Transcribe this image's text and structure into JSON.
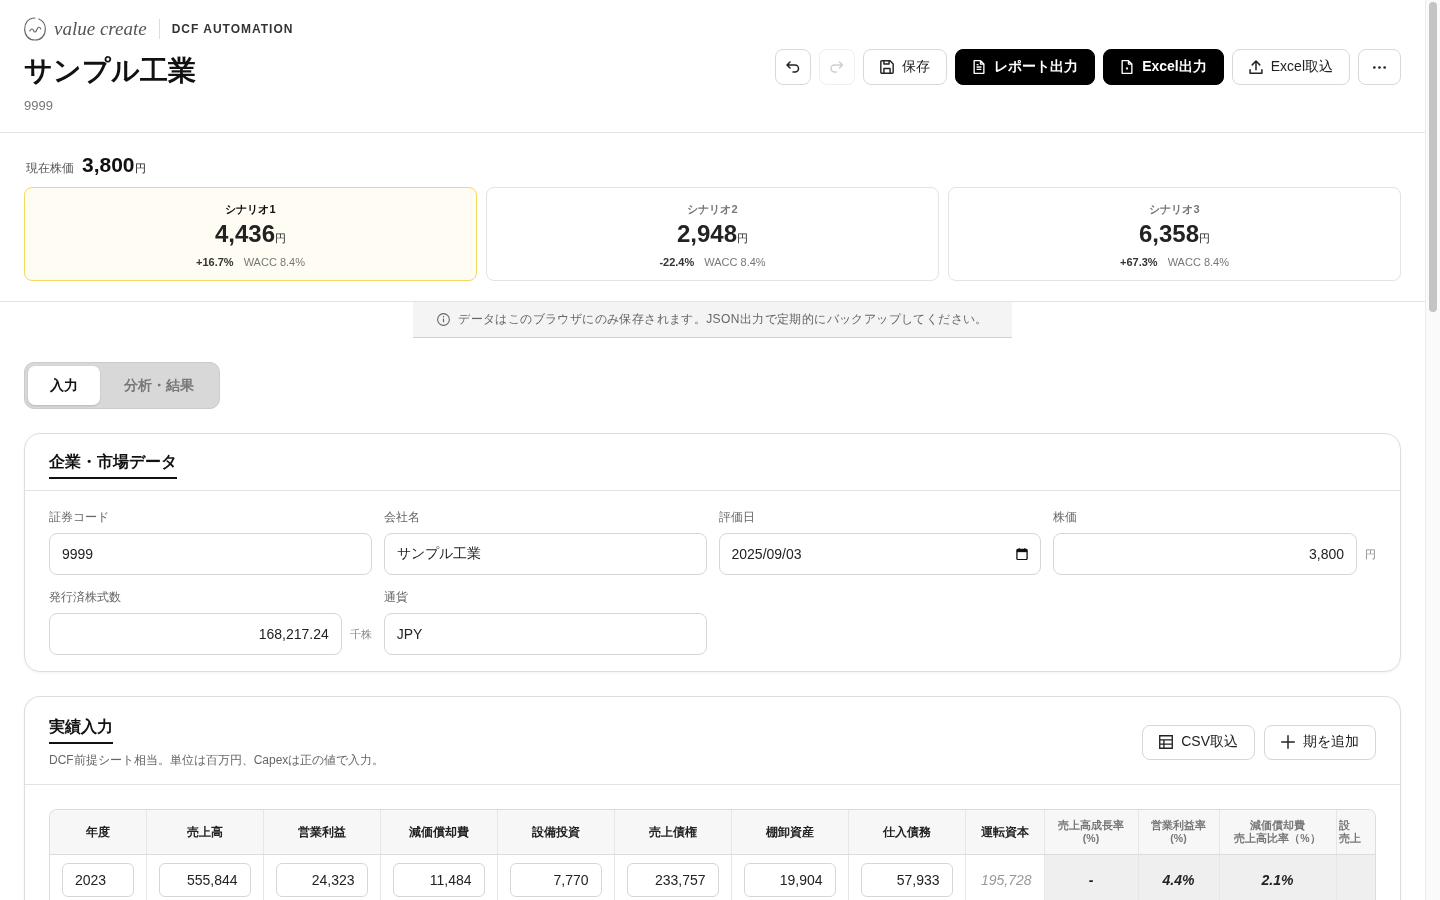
{
  "header": {
    "brand": "value create",
    "product": "DCF AUTOMATION",
    "company_name": "サンプル工業",
    "code": "9999"
  },
  "toolbar": [
    {
      "kind": "undo",
      "disabled": false,
      "primary": false
    },
    {
      "kind": "redo",
      "disabled": true,
      "primary": false
    },
    {
      "kind": "save",
      "label": "保存",
      "disabled": false,
      "primary": false
    },
    {
      "kind": "report",
      "label": "レポート出力",
      "disabled": false,
      "primary": true
    },
    {
      "kind": "excel_export",
      "label": "Excel出力",
      "disabled": false,
      "primary": true
    },
    {
      "kind": "excel_import",
      "label": "Excel取込",
      "disabled": false,
      "primary": false
    },
    {
      "kind": "more",
      "disabled": false,
      "primary": false
    }
  ],
  "current_price": {
    "label": "現在株価",
    "value": "3,800",
    "unit": "円"
  },
  "scenarios": [
    {
      "name": "シナリオ1",
      "value": "4,436",
      "unit": "円",
      "change": "+16.7%",
      "wacc": "WACC 8.4%",
      "selected": true
    },
    {
      "name": "シナリオ2",
      "value": "2,948",
      "unit": "円",
      "change": "-22.4%",
      "wacc": "WACC 8.4%",
      "selected": false
    },
    {
      "name": "シナリオ3",
      "value": "6,358",
      "unit": "円",
      "change": "+67.3%",
      "wacc": "WACC 8.4%",
      "selected": false
    }
  ],
  "notice": {
    "text": "データはこのブラウザにのみ保存されます。JSON出力で定期的にバックアップしてください。"
  },
  "tabs": [
    {
      "label": "入力",
      "selected": true
    },
    {
      "label": "分析・結果",
      "selected": false
    }
  ],
  "company_section": {
    "title": "企業・市場データ",
    "fields": [
      {
        "label": "証券コード",
        "kind": "text",
        "value": "9999"
      },
      {
        "label": "会社名",
        "kind": "text",
        "value": "サンプル工業"
      },
      {
        "label": "評価日",
        "kind": "date",
        "value": "2025/09/03"
      },
      {
        "label": "株価",
        "kind": "number",
        "value": "3,800",
        "unit": "円"
      },
      {
        "label": "発行済株式数",
        "kind": "number",
        "value": "168,217.24",
        "unit": "千株"
      },
      {
        "label": "通貨",
        "kind": "text",
        "value": "JPY"
      }
    ]
  },
  "history_section": {
    "title": "実績入力",
    "description": "DCF前提シート相当。単位は百万円、Capexは正の値で入力。",
    "buttons": [
      {
        "kind": "table",
        "label": "CSV取込"
      },
      {
        "kind": "plus",
        "label": "期を追加"
      }
    ],
    "table": {
      "columns": [
        {
          "lines": [
            "年度"
          ],
          "kind": "year"
        },
        {
          "lines": [
            "売上高"
          ],
          "kind": "amount"
        },
        {
          "lines": [
            "営業利益"
          ],
          "kind": "amount"
        },
        {
          "lines": [
            "減価償却費"
          ],
          "kind": "amount"
        },
        {
          "lines": [
            "設備投資"
          ],
          "kind": "amount"
        },
        {
          "lines": [
            "売上債権"
          ],
          "kind": "amount"
        },
        {
          "lines": [
            "棚卸資産"
          ],
          "kind": "amount"
        },
        {
          "lines": [
            "仕入債務"
          ],
          "kind": "amount"
        },
        {
          "lines": [
            "運転資本"
          ],
          "kind": "computed"
        },
        {
          "lines": [
            "売上高成長率",
            "(%)"
          ],
          "kind": "ratio"
        },
        {
          "lines": [
            "営業利益率",
            "(%)"
          ],
          "kind": "ratio"
        },
        {
          "lines": [
            "減価償却費",
            "売上高比率（%）"
          ],
          "kind": "ratio"
        },
        {
          "lines": [
            "設",
            "売上"
          ],
          "kind": "ratio"
        }
      ],
      "rows": [
        {
          "values": [
            "2023",
            "555,844",
            "24,323",
            "11,484",
            "7,770",
            "233,757",
            "19,904",
            "57,933",
            "195,728",
            "-",
            "4.4%",
            "2.1%"
          ]
        }
      ]
    }
  }
}
